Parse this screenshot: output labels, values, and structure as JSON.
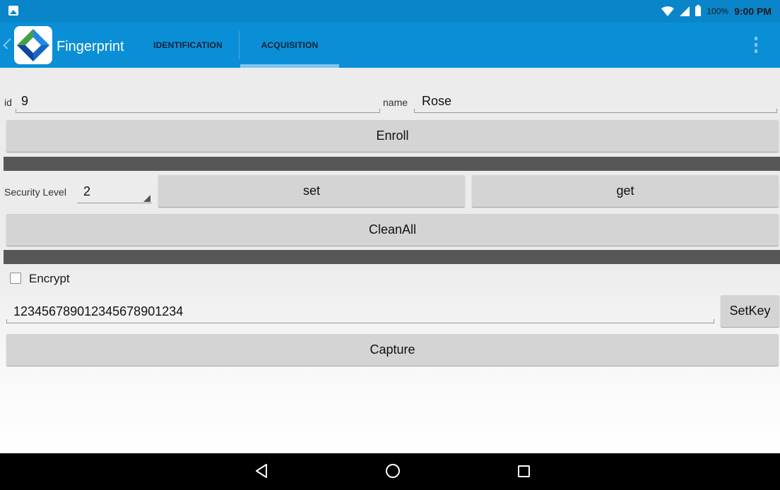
{
  "status_bar": {
    "battery": "100%",
    "time": "9:00 PM"
  },
  "app_bar": {
    "title": "Fingerprint",
    "tabs": [
      {
        "label": "IDENTIFICATION",
        "selected": false
      },
      {
        "label": "ACQUISITION",
        "selected": true
      }
    ],
    "colors": {
      "primary": "#0a8fd6",
      "status": "#0a85c9",
      "indicator": "#7fc7ee"
    }
  },
  "enroll_section": {
    "id_label": "id",
    "id_value": "9",
    "name_label": "name",
    "name_value": "Rose",
    "enroll_button": "Enroll"
  },
  "security_section": {
    "label": "Security Level",
    "selected_level": "2",
    "set_button": "set",
    "get_button": "get",
    "clean_button": "CleanAll"
  },
  "capture_section": {
    "encrypt_label": "Encrypt",
    "encrypt_checked": false,
    "key_value": "123456789012345678901234",
    "setkey_button": "SetKey",
    "capture_button": "Capture"
  },
  "nav_bar": {
    "icons": [
      "back-icon",
      "home-icon",
      "recents-icon"
    ]
  }
}
